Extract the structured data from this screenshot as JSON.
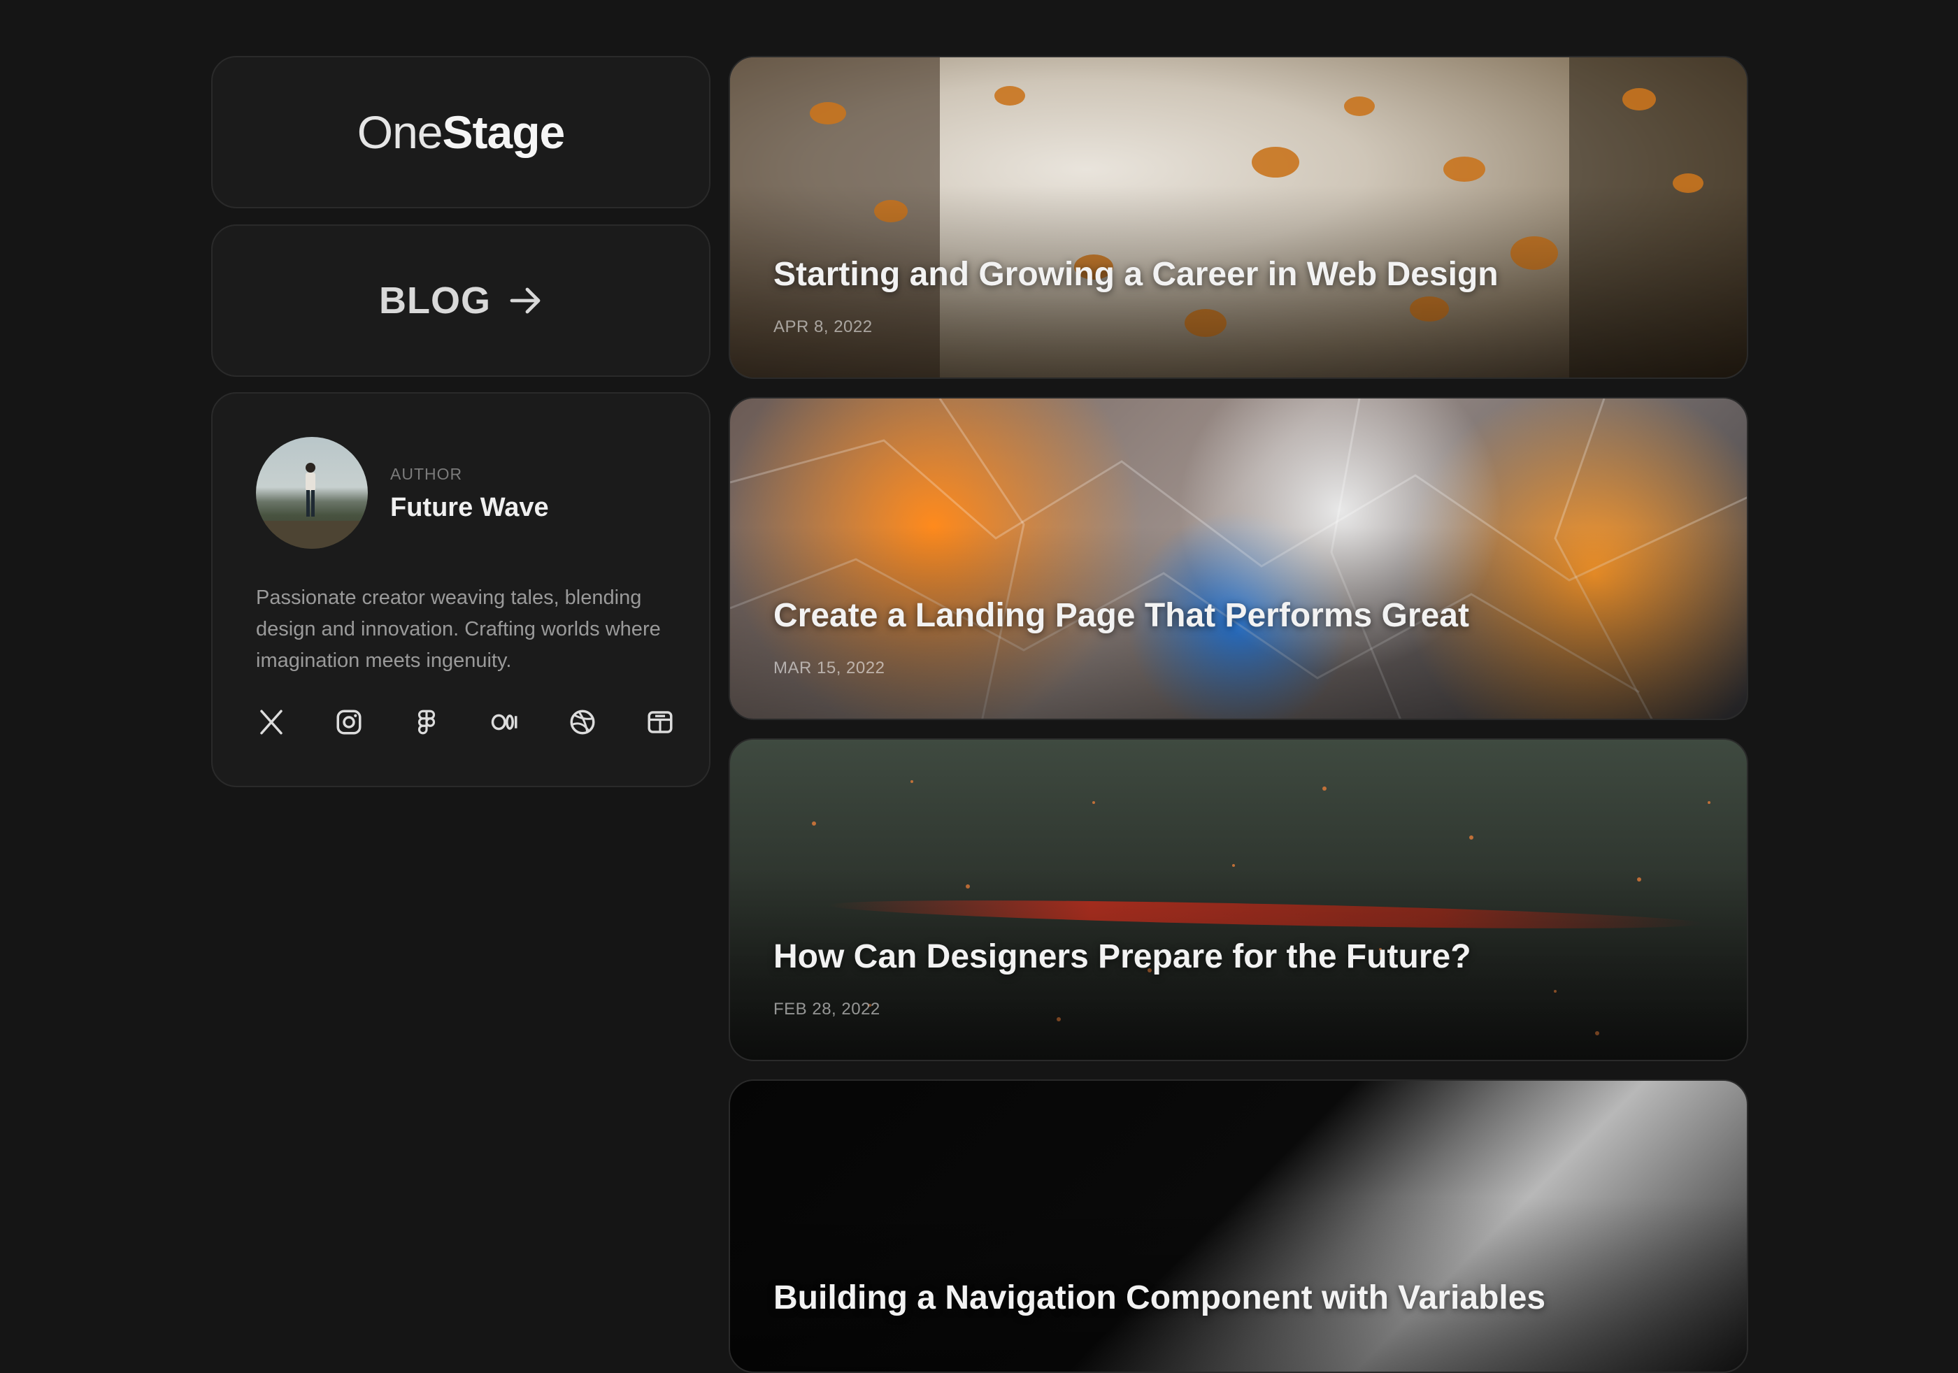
{
  "logo": {
    "light": "One",
    "bold": "Stage"
  },
  "blog": {
    "label": "BLOG"
  },
  "author": {
    "eyebrow": "AUTHOR",
    "name": "Future Wave",
    "bio": "Passionate creator weaving tales, blending design and innovation. Crafting worlds where imagination meets ingenuity.",
    "socials": [
      "x-icon",
      "instagram-icon",
      "figma-icon",
      "medium-icon",
      "dribbble-icon",
      "framer-icon"
    ]
  },
  "posts": [
    {
      "title": "Starting and Growing a Career in Web Design",
      "date": "APR 8, 2022"
    },
    {
      "title": "Create a Landing Page That Performs Great",
      "date": "MAR 15, 2022"
    },
    {
      "title": "How Can Designers Prepare for the Future?",
      "date": "FEB 28, 2022"
    },
    {
      "title": "Building a Navigation Component with Variables",
      "date": ""
    }
  ],
  "colors": {
    "background": "#151515",
    "card": "#1b1b1b",
    "border": "#2a2a2a",
    "text": "#ededed",
    "muted": "#9a9a9a"
  }
}
